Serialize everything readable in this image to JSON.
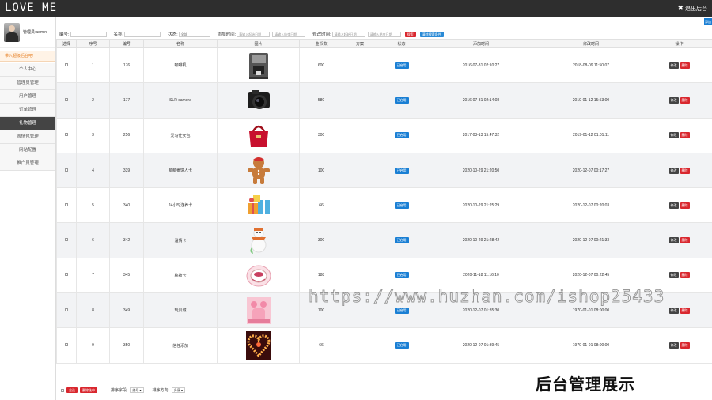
{
  "app": {
    "logo": "LOVE ME",
    "exit_label": "退出后台"
  },
  "sidebar": {
    "user_name": "管理员:admin",
    "welcome": "带入超级后台吧!",
    "items": [
      {
        "label": "个人中心"
      },
      {
        "label": "管理员管理"
      },
      {
        "label": "用户管理"
      },
      {
        "label": "订单管理"
      },
      {
        "label": "礼物管理",
        "active": true
      },
      {
        "label": "表情包管理"
      },
      {
        "label": "网站配置"
      },
      {
        "label": "推广员管理"
      }
    ]
  },
  "filter": {
    "top_button": "添加",
    "id_label": "编号:",
    "name_label": "名称:",
    "status_label": "状态:",
    "status_value": "全部",
    "added_label": "添加时间:",
    "modified_label": "修改时间:",
    "start_placeholder": "请输入起始日期",
    "end_placeholder": "请输入结束日期",
    "search_button": "搜索",
    "reset_button": "清除搜索条件"
  },
  "table": {
    "headers": [
      "选择",
      "序号",
      "编号",
      "名称",
      "图片",
      "金币数",
      "方案",
      "状态",
      "添加时间",
      "修改时间",
      "操作"
    ],
    "status_text": "已启用",
    "edit_label": "修改",
    "delete_label": "删除",
    "rows": [
      {
        "seq": "1",
        "id": "176",
        "name": "咖啡机",
        "coins": "600",
        "plan": "",
        "added": "2016-07-31 02:10:27",
        "modified": "2018-08-09 11:50:07",
        "pic": "coffee-machine"
      },
      {
        "seq": "2",
        "id": "177",
        "name": "SLR camera",
        "coins": "580",
        "plan": "",
        "added": "2016-07-31 02:14:08",
        "modified": "2019-01-12 15:53:00",
        "pic": "camera"
      },
      {
        "seq": "3",
        "id": "256",
        "name": "爱马仕女包",
        "coins": "300",
        "plan": "",
        "added": "2017-03-13 15:47:32",
        "modified": "2019-01-12 01:01:11",
        "pic": "handbag"
      },
      {
        "seq": "4",
        "id": "339",
        "name": "萌萌姜饼人卡",
        "coins": "100",
        "plan": "",
        "added": "2020-10-29 21:20:50",
        "modified": "2020-12-07 00:17:27",
        "pic": "gingerbread"
      },
      {
        "seq": "5",
        "id": "340",
        "name": "24小时送养卡",
        "coins": "66",
        "plan": "",
        "added": "2020-10-29 21:25:29",
        "modified": "2020-12-07 00:20:03",
        "pic": "gift-boxes"
      },
      {
        "seq": "6",
        "id": "342",
        "name": "温情卡",
        "coins": "300",
        "plan": "",
        "added": "2020-10-29 21:28:42",
        "modified": "2020-12-07 00:21:33",
        "pic": "snowman"
      },
      {
        "seq": "7",
        "id": "345",
        "name": "棉被卡",
        "coins": "188",
        "plan": "",
        "added": "2020-11-18 11:16:10",
        "modified": "2020-12-07 00:22:45",
        "pic": "cake"
      },
      {
        "seq": "8",
        "id": "349",
        "name": "玩具城",
        "coins": "100",
        "plan": "",
        "added": "2020-12-07 01:35:30",
        "modified": "1970-01-01 08:00:00",
        "pic": "pink-toys"
      },
      {
        "seq": "9",
        "id": "350",
        "name": "信任添加",
        "coins": "66",
        "plan": "",
        "added": "2020-12-07 01:39:45",
        "modified": "1970-01-01 08:00:00",
        "pic": "heart-candles"
      }
    ]
  },
  "footer": {
    "select_all": "全选",
    "delete_selected": "删除选中",
    "sort_field_label": "排序字段:",
    "sort_field_value": "编号",
    "sort_dir_label": "排序方向:",
    "sort_dir_value": "升序"
  },
  "overlay": {
    "watermark": "https://www.huzhan.com/ishop25433",
    "showcase": "后台管理展示"
  },
  "colors": {
    "topbar": "#2e2e2e",
    "status_blue": "#1a7fd4",
    "danger_red": "#d9272e",
    "accent_orange": "#e67e22"
  }
}
